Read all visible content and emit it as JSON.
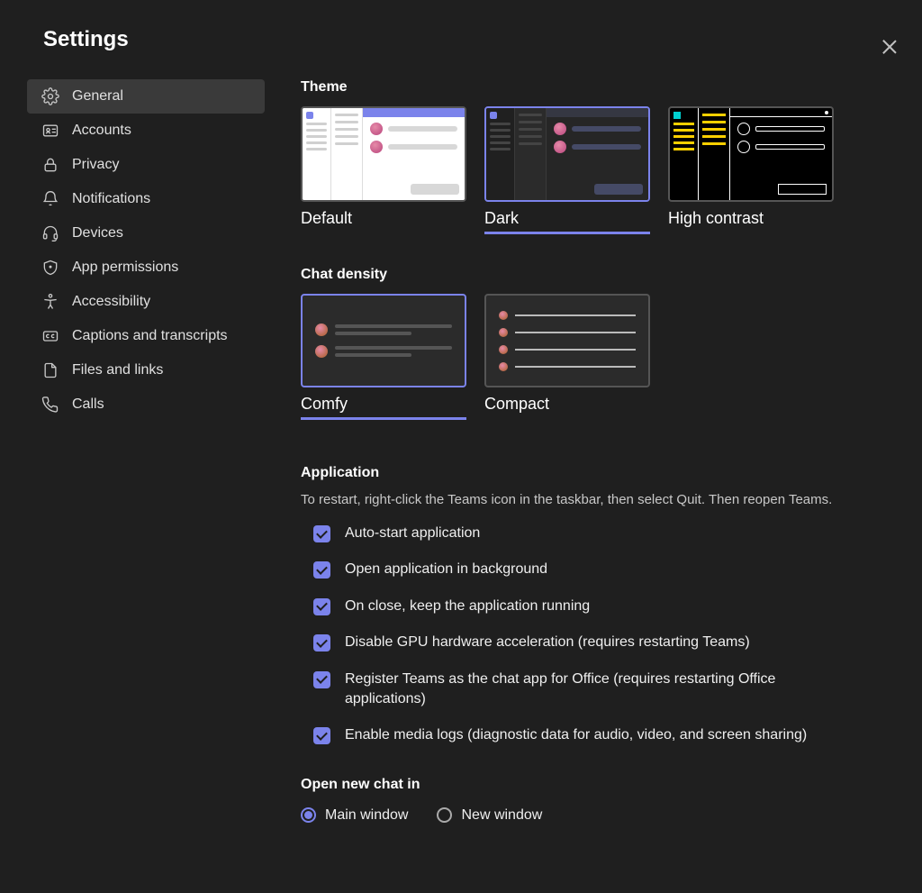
{
  "title": "Settings",
  "sidebar": {
    "items": [
      {
        "label": "General",
        "selected": true
      },
      {
        "label": "Accounts"
      },
      {
        "label": "Privacy"
      },
      {
        "label": "Notifications"
      },
      {
        "label": "Devices"
      },
      {
        "label": "App permissions"
      },
      {
        "label": "Accessibility"
      },
      {
        "label": "Captions and transcripts"
      },
      {
        "label": "Files and links"
      },
      {
        "label": "Calls"
      }
    ]
  },
  "sections": {
    "theme": {
      "title": "Theme",
      "options": [
        {
          "label": "Default"
        },
        {
          "label": "Dark",
          "selected": true
        },
        {
          "label": "High contrast"
        }
      ]
    },
    "density": {
      "title": "Chat density",
      "options": [
        {
          "label": "Comfy",
          "selected": true
        },
        {
          "label": "Compact"
        }
      ]
    },
    "application": {
      "title": "Application",
      "description": "To restart, right-click the Teams icon in the taskbar, then select Quit. Then reopen Teams.",
      "checks": [
        {
          "label": "Auto-start application",
          "checked": true
        },
        {
          "label": "Open application in background",
          "checked": true
        },
        {
          "label": "On close, keep the application running",
          "checked": true
        },
        {
          "label": "Disable GPU hardware acceleration (requires restarting Teams)",
          "checked": true
        },
        {
          "label": "Register Teams as the chat app for Office (requires restarting Office applications)",
          "checked": true
        },
        {
          "label": "Enable media logs (diagnostic data for audio, video, and screen sharing)",
          "checked": true
        }
      ]
    },
    "open_chat": {
      "title": "Open new chat in",
      "options": [
        {
          "label": "Main window",
          "selected": true
        },
        {
          "label": "New window"
        }
      ]
    }
  }
}
